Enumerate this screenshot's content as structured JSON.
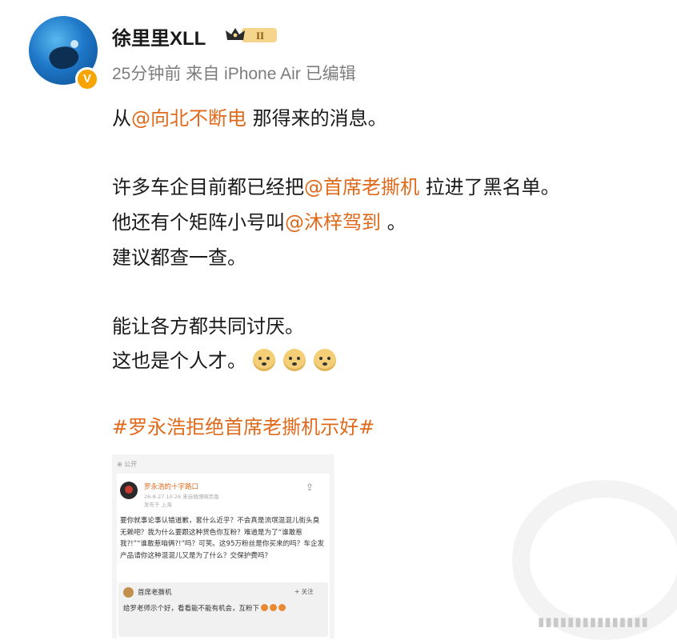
{
  "post": {
    "username": "徐里里XLL",
    "level_badge": "II",
    "verified_badge": "V",
    "meta": "25分钟前  来自 iPhone Air  已编辑",
    "line1": {
      "prefix": "从",
      "mention": "@向北不断电",
      "suffix": " 那得来的消息。"
    },
    "line2": {
      "prefix": "许多车企目前都已经把",
      "mention": "@首席老撕机",
      "suffix": " 拉进了黑名单。"
    },
    "line3": {
      "prefix": "他还有个矩阵小号叫",
      "mention": "@沐梓驾到",
      "suffix": " 。"
    },
    "line4": "建议都查一查。",
    "line5": "能让各方都共同讨厌。",
    "line6": "这也是个人才。",
    "emoji": [
      "doge",
      "doge",
      "doge"
    ],
    "hashtag": "#罗永浩拒绝首席老撕机示好#"
  },
  "embedded": {
    "visibility": "公开",
    "author": "罗永浩的十字路口",
    "time": "26-8-27 10:26  来自微博网页版",
    "location": "发布于 上海",
    "share_icon": "share-icon",
    "body": "要你就事论事认错道歉，套什么近乎？不会真是流氓混混儿街头臭无赖吧？我为什么要跟这种货色你互粉？难道是为了“谁敢惹我?!”“谁敢惹咱俩?!”吗？可笑。这95万粉丝是你买来的吗？车企发产品请你这种混混儿又是为了什么？交保护费吗？",
    "comment": {
      "author": "首席老撕机",
      "follow": "+ 关注",
      "text": "给罗老师示个好，看看能不能有机会，互粉下"
    }
  },
  "colors": {
    "accent": "#e06a1c",
    "meta": "#7d7d7d",
    "verified": "#f7a400"
  }
}
